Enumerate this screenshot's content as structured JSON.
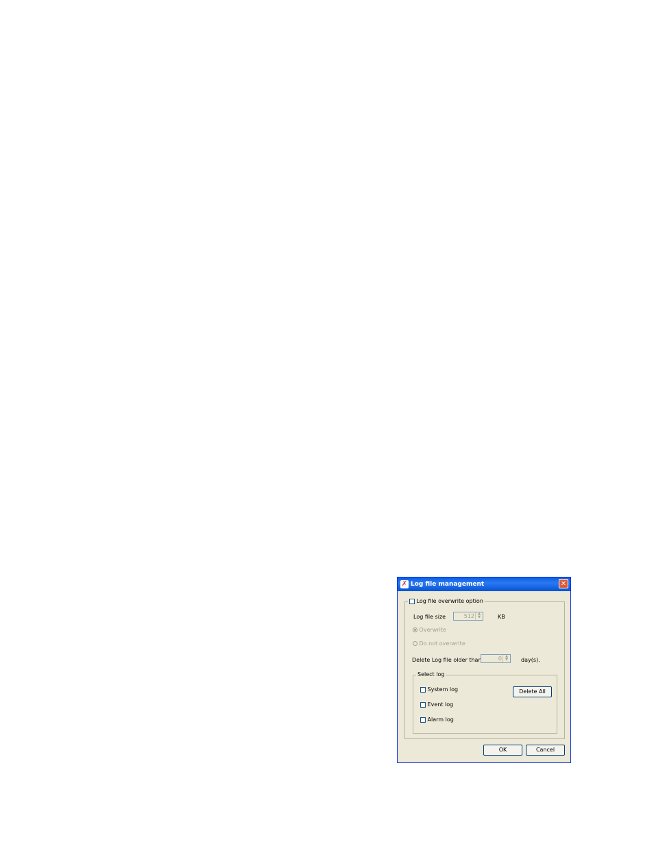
{
  "dialog": {
    "title": "Log file management",
    "overwrite_option": {
      "label": "Log file overwrite option",
      "checked": false
    },
    "log_file_size": {
      "label": "Log file size",
      "value": "512",
      "unit": "KB"
    },
    "overwrite_radio": {
      "label": "Overwrite",
      "selected": true
    },
    "no_overwrite_radio": {
      "label": "Do not overwrite",
      "selected": false
    },
    "delete_older": {
      "label": "Delete Log file older than",
      "value": "0",
      "unit": "day(s)."
    },
    "select_log": {
      "legend": "Select log",
      "items": [
        {
          "label": "System log",
          "checked": false
        },
        {
          "label": "Event log",
          "checked": false
        },
        {
          "label": "Alarm log",
          "checked": false
        }
      ],
      "delete_all_label": "Delete All"
    },
    "ok_label": "OK",
    "cancel_label": "Cancel"
  }
}
